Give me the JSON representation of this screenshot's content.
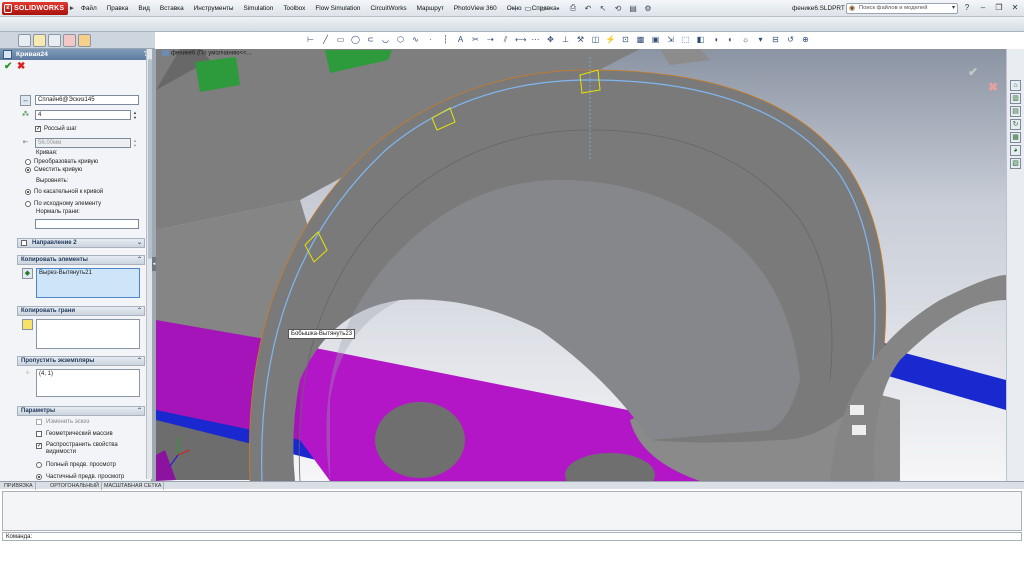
{
  "app": {
    "logo_text": "SOLIDWORKS",
    "document_title": "фенике6.SLDPRT *",
    "search_placeholder": "Поиск файлов и моделей"
  },
  "menu": [
    "Файл",
    "Правка",
    "Вид",
    "Вставка",
    "Инструменты",
    "Simulation",
    "Toolbox",
    "Flow Simulation",
    "CircuitWorks",
    "Маршрут",
    "PhotoView 360",
    "Окно",
    "Справка"
  ],
  "tree_flyout": "фенике6 (По умолчанию<<...",
  "pm": {
    "title": "Кривая24",
    "help": "?",
    "curve_value": "Сплайн6@Эскиз145",
    "count_value": "4",
    "rough_step_label": "Россый шаг",
    "distance_value": "56.00мм",
    "curve_section_label": "Кривая:",
    "opt_transform": "Преобразовать кривую",
    "opt_offset": "Сместить кривую",
    "align_label": "Выровнять:",
    "opt_tangent": "По касательной к кривой",
    "opt_original": "По исходному элементу",
    "face_normal_label": "Нормаль грани:",
    "direction2": "Направление 2",
    "copy_features_header": "Копировать элементы",
    "copy_features_item": "Вырез-Вытянуть21",
    "copy_faces_header": "Копировать грани",
    "skip_header": "Пропустить экземпляры",
    "skip_item": "(4, 1)",
    "params_header": "Параметры",
    "param_change_sketch": "Изменить эскиз",
    "param_geometric": "Геометрический массив",
    "param_propagate": "Распространить свойства видимости",
    "param_full_preview": "Полный предв. просмотр",
    "param_partial_preview": "Частичный предв. просмотр"
  },
  "viewport": {
    "tooltip": "Бобышка-Вытянуть23"
  },
  "status_tabs": [
    "ПРИВЯЗКА",
    "ОРТОГОНАЛЬНЫЙ",
    "МАСШТАБНАЯ СЕТКА"
  ],
  "command_label": "Команда:",
  "colors": {
    "bg_top": "#8f98a6",
    "bg_bottom": "#f5f5f7",
    "part_gray": "#7f7f7f",
    "part_edge": "#a6a6a6",
    "magenta": "#b316c8",
    "blue_rod": "#1b2ad0",
    "green": "#2e9a3c",
    "curve_line": "#7fb7f2",
    "preview_yellow": "#e8e400"
  }
}
